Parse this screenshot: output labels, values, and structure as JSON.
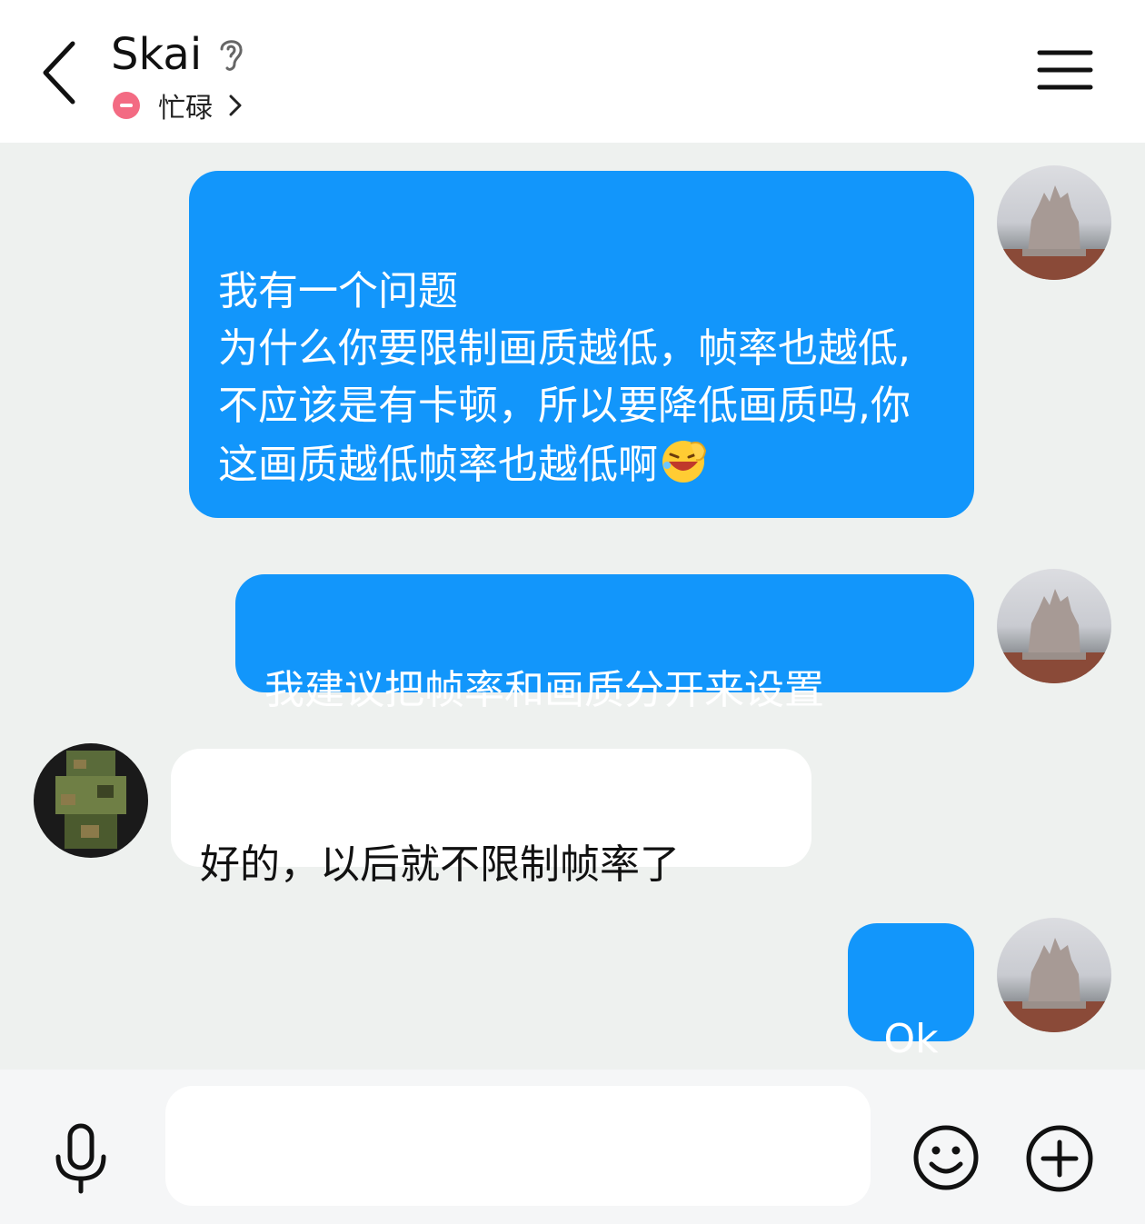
{
  "header": {
    "title": "Skai",
    "status": "忙碌",
    "icons": {
      "back": "back-arrow-icon",
      "ear": "ear-icon",
      "status": "busy-status-icon",
      "chevron": "chevron-right-icon",
      "menu": "menu-icon"
    }
  },
  "messages": [
    {
      "direction": "outgoing",
      "text": "我有一个问题\n为什么你要限制画质越低，帧率也越低,不应该是有卡顿，所以要降低画质吗,你这画质越低帧率也越低啊",
      "emoji": "laughing-tears-emoji"
    },
    {
      "direction": "outgoing",
      "text": "我建议把帧率和画质分开来设置"
    },
    {
      "direction": "incoming",
      "text": "好的，以后就不限制帧率了"
    },
    {
      "direction": "outgoing",
      "text": "Ok"
    }
  ],
  "input": {
    "placeholder": ""
  },
  "bottom_icons": {
    "mic": "microphone-icon",
    "emoji": "smiley-icon",
    "plus": "plus-circle-icon"
  },
  "colors": {
    "outgoing_bubble": "#1296fb",
    "incoming_bubble": "#ffffff",
    "chat_bg": "#eef1ef",
    "busy": "#f36b83"
  }
}
